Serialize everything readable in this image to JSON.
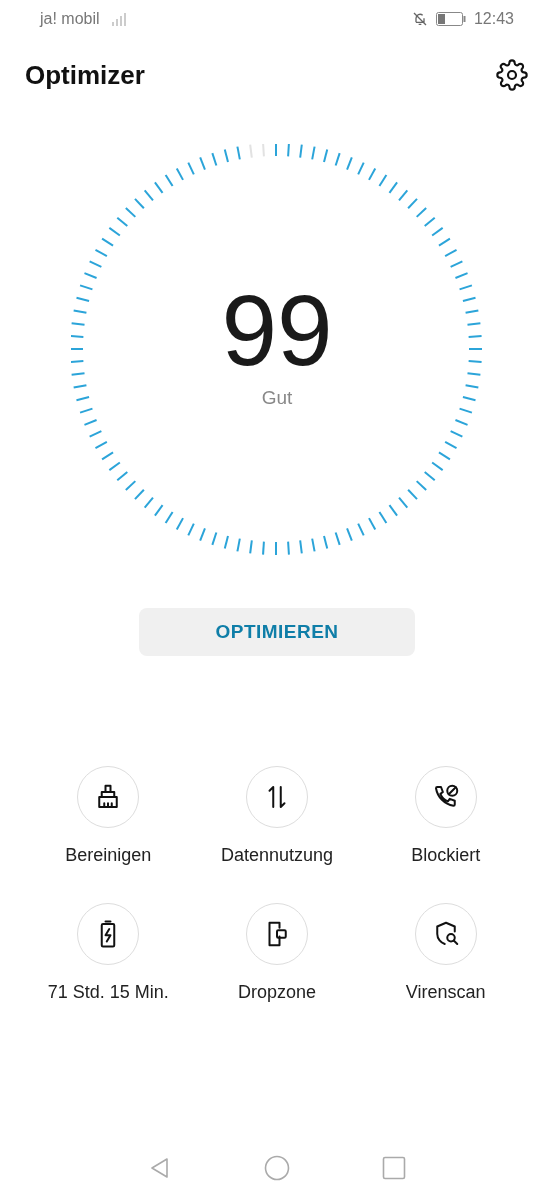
{
  "status_bar": {
    "carrier": "ja! mobil",
    "time": "12:43"
  },
  "header": {
    "title": "Optimizer"
  },
  "score": {
    "value": "99",
    "label": "Gut"
  },
  "optimize_button": "OPTIMIEREN",
  "tools": [
    {
      "kind": "broom",
      "label": "Bereinigen"
    },
    {
      "kind": "transfer",
      "label": "Datennutzung"
    },
    {
      "kind": "blocked-call",
      "label": "Blockiert"
    },
    {
      "kind": "battery",
      "label": "71 Std. 15 Min."
    },
    {
      "kind": "dropzone",
      "label": "Dropzone"
    },
    {
      "kind": "virus-scan",
      "label": "Virenscan"
    }
  ]
}
